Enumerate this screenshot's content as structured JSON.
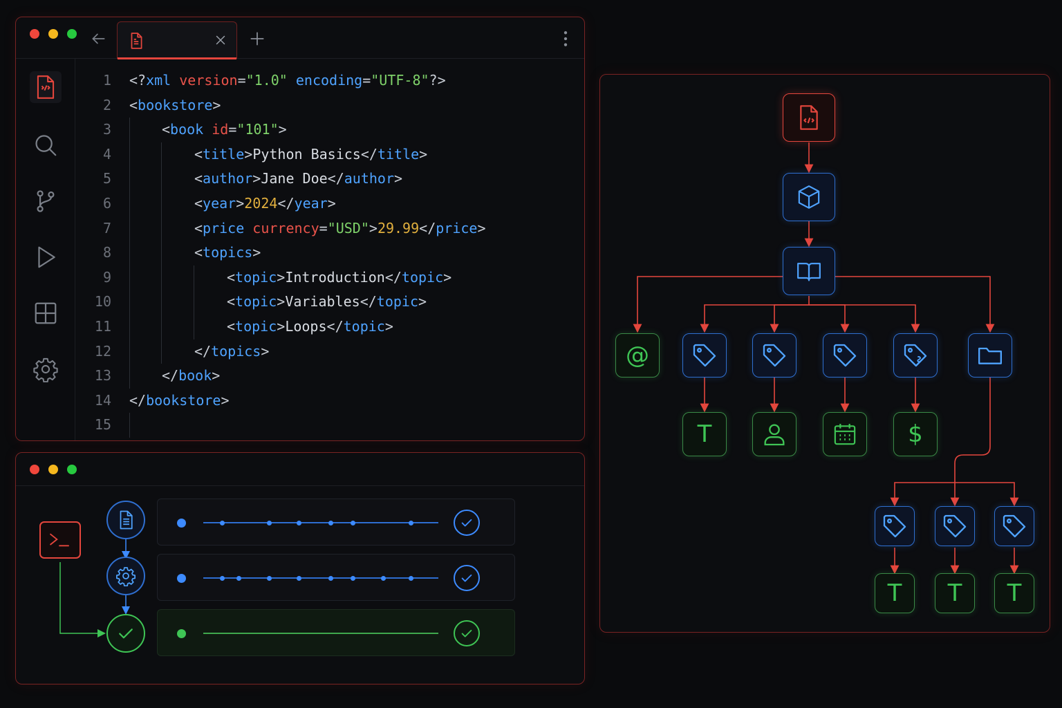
{
  "editor": {
    "tab": {
      "label": "",
      "active": true
    },
    "activity_bar": [
      {
        "name": "explorer-icon",
        "active": true
      },
      {
        "name": "search-icon",
        "active": false
      },
      {
        "name": "source-control-icon",
        "active": false
      },
      {
        "name": "run-icon",
        "active": false
      },
      {
        "name": "extensions-icon",
        "active": false
      },
      {
        "name": "settings-icon",
        "active": false
      }
    ],
    "lines": [
      {
        "n": "1",
        "indent": 0,
        "tokens": [
          [
            "punc",
            "<?"
          ],
          [
            "tag",
            "xml "
          ],
          [
            "attr",
            "version"
          ],
          [
            "punc",
            "="
          ],
          [
            "str",
            "\"1.0\" "
          ],
          [
            "tag",
            "encoding"
          ],
          [
            "punc",
            "="
          ],
          [
            "str",
            "\"UTF-8\""
          ],
          [
            "punc",
            "?>"
          ]
        ]
      },
      {
        "n": "2",
        "indent": 0,
        "tokens": [
          [
            "punc",
            "<"
          ],
          [
            "tag",
            "bookstore"
          ],
          [
            "punc",
            ">"
          ]
        ]
      },
      {
        "n": "3",
        "indent": 1,
        "tokens": [
          [
            "punc",
            "<"
          ],
          [
            "tag",
            "book "
          ],
          [
            "attr",
            "id"
          ],
          [
            "punc",
            "="
          ],
          [
            "str",
            "\"101\""
          ],
          [
            "punc",
            ">"
          ]
        ]
      },
      {
        "n": "4",
        "indent": 2,
        "tokens": [
          [
            "punc",
            "<"
          ],
          [
            "tag",
            "title"
          ],
          [
            "punc",
            ">"
          ],
          [
            "text",
            "Python Basics"
          ],
          [
            "punc",
            "</"
          ],
          [
            "tag",
            "title"
          ],
          [
            "punc",
            ">"
          ]
        ]
      },
      {
        "n": "5",
        "indent": 2,
        "tokens": [
          [
            "punc",
            "<"
          ],
          [
            "tag",
            "author"
          ],
          [
            "punc",
            ">"
          ],
          [
            "text",
            "Jane Doe"
          ],
          [
            "punc",
            "</"
          ],
          [
            "tag",
            "author"
          ],
          [
            "punc",
            ">"
          ]
        ]
      },
      {
        "n": "6",
        "indent": 2,
        "tokens": [
          [
            "punc",
            "<"
          ],
          [
            "tag",
            "year"
          ],
          [
            "punc",
            ">"
          ],
          [
            "num",
            "2024"
          ],
          [
            "punc",
            "</"
          ],
          [
            "tag",
            "year"
          ],
          [
            "punc",
            ">"
          ]
        ]
      },
      {
        "n": "7",
        "indent": 2,
        "tokens": [
          [
            "punc",
            "<"
          ],
          [
            "tag",
            "price "
          ],
          [
            "attr",
            "currency"
          ],
          [
            "punc",
            "="
          ],
          [
            "str",
            "\"USD\""
          ],
          [
            "punc",
            ">"
          ],
          [
            "num",
            "29.99"
          ],
          [
            "punc",
            "</"
          ],
          [
            "tag",
            "price"
          ],
          [
            "punc",
            ">"
          ]
        ]
      },
      {
        "n": "8",
        "indent": 2,
        "tokens": [
          [
            "punc",
            "<"
          ],
          [
            "tag",
            "topics"
          ],
          [
            "punc",
            ">"
          ]
        ]
      },
      {
        "n": "9",
        "indent": 3,
        "tokens": [
          [
            "punc",
            "<"
          ],
          [
            "tag",
            "topic"
          ],
          [
            "punc",
            ">"
          ],
          [
            "text",
            "Introduction"
          ],
          [
            "punc",
            "</"
          ],
          [
            "tag",
            "topic"
          ],
          [
            "punc",
            ">"
          ]
        ]
      },
      {
        "n": "10",
        "indent": 3,
        "tokens": [
          [
            "punc",
            "<"
          ],
          [
            "tag",
            "topic"
          ],
          [
            "punc",
            ">"
          ],
          [
            "text",
            "Variables"
          ],
          [
            "punc",
            "</"
          ],
          [
            "tag",
            "topic"
          ],
          [
            "punc",
            ">"
          ]
        ]
      },
      {
        "n": "11",
        "indent": 3,
        "tokens": [
          [
            "punc",
            "<"
          ],
          [
            "tag",
            "topic"
          ],
          [
            "punc",
            ">"
          ],
          [
            "text",
            "Loops"
          ],
          [
            "punc",
            "</"
          ],
          [
            "tag",
            "topic"
          ],
          [
            "punc",
            ">"
          ]
        ]
      },
      {
        "n": "12",
        "indent": 2,
        "tokens": [
          [
            "punc",
            "</"
          ],
          [
            "tag",
            "topics"
          ],
          [
            "punc",
            ">"
          ]
        ]
      },
      {
        "n": "13",
        "indent": 1,
        "tokens": [
          [
            "punc",
            "</"
          ],
          [
            "tag",
            "book"
          ],
          [
            "punc",
            ">"
          ]
        ]
      },
      {
        "n": "14",
        "indent": 0,
        "tokens": [
          [
            "punc",
            "</"
          ],
          [
            "tag",
            "bookstore"
          ],
          [
            "punc",
            ">"
          ]
        ]
      },
      {
        "n": "15",
        "indent": 0,
        "tokens": []
      }
    ]
  },
  "terminal": {
    "pipeline": [
      {
        "step_icon": "document-icon",
        "state": "passed",
        "status_text": ""
      },
      {
        "step_icon": "gear-icon",
        "state": "passed",
        "status_text": ""
      },
      {
        "step_icon": "check-icon",
        "state": "done",
        "status_text": ""
      }
    ]
  },
  "tree": {
    "nodes": [
      {
        "id": "root",
        "icon": "xml-file-icon",
        "variant": "red",
        "glyph": ""
      },
      {
        "id": "bookstore",
        "icon": "package-icon",
        "variant": "blue",
        "glyph": ""
      },
      {
        "id": "book",
        "icon": "book-icon",
        "variant": "blue",
        "glyph": ""
      },
      {
        "id": "id-attr",
        "icon": "at-icon",
        "variant": "green",
        "glyph": "@"
      },
      {
        "id": "title",
        "icon": "tag-icon",
        "variant": "blue",
        "glyph": ""
      },
      {
        "id": "author",
        "icon": "tag-icon",
        "variant": "blue",
        "glyph": ""
      },
      {
        "id": "year",
        "icon": "tag-icon",
        "variant": "blue",
        "glyph": ""
      },
      {
        "id": "price",
        "icon": "tag-attr-icon",
        "variant": "blue",
        "glyph": ""
      },
      {
        "id": "topics",
        "icon": "folder-icon",
        "variant": "blue",
        "glyph": ""
      },
      {
        "id": "title-text",
        "icon": "text-icon",
        "variant": "green",
        "glyph": "T"
      },
      {
        "id": "author-val",
        "icon": "person-icon",
        "variant": "green",
        "glyph": ""
      },
      {
        "id": "year-val",
        "icon": "calendar-icon",
        "variant": "green",
        "glyph": ""
      },
      {
        "id": "price-val",
        "icon": "dollar-icon",
        "variant": "green",
        "glyph": "$"
      },
      {
        "id": "topic-1",
        "icon": "tag-icon",
        "variant": "blue",
        "glyph": ""
      },
      {
        "id": "topic-2",
        "icon": "tag-icon",
        "variant": "blue",
        "glyph": ""
      },
      {
        "id": "topic-3",
        "icon": "tag-icon",
        "variant": "blue",
        "glyph": ""
      },
      {
        "id": "topic-1-text",
        "icon": "text-icon",
        "variant": "green",
        "glyph": "T"
      },
      {
        "id": "topic-2-text",
        "icon": "text-icon",
        "variant": "green",
        "glyph": "T"
      },
      {
        "id": "topic-3-text",
        "icon": "text-icon",
        "variant": "green",
        "glyph": "T"
      }
    ]
  },
  "colors": {
    "accent_red": "#e5463d",
    "tag_blue": "#4fa3ff",
    "string_green": "#7fd26a",
    "number_amber": "#e2b03e",
    "background": "#0a0b0d"
  }
}
